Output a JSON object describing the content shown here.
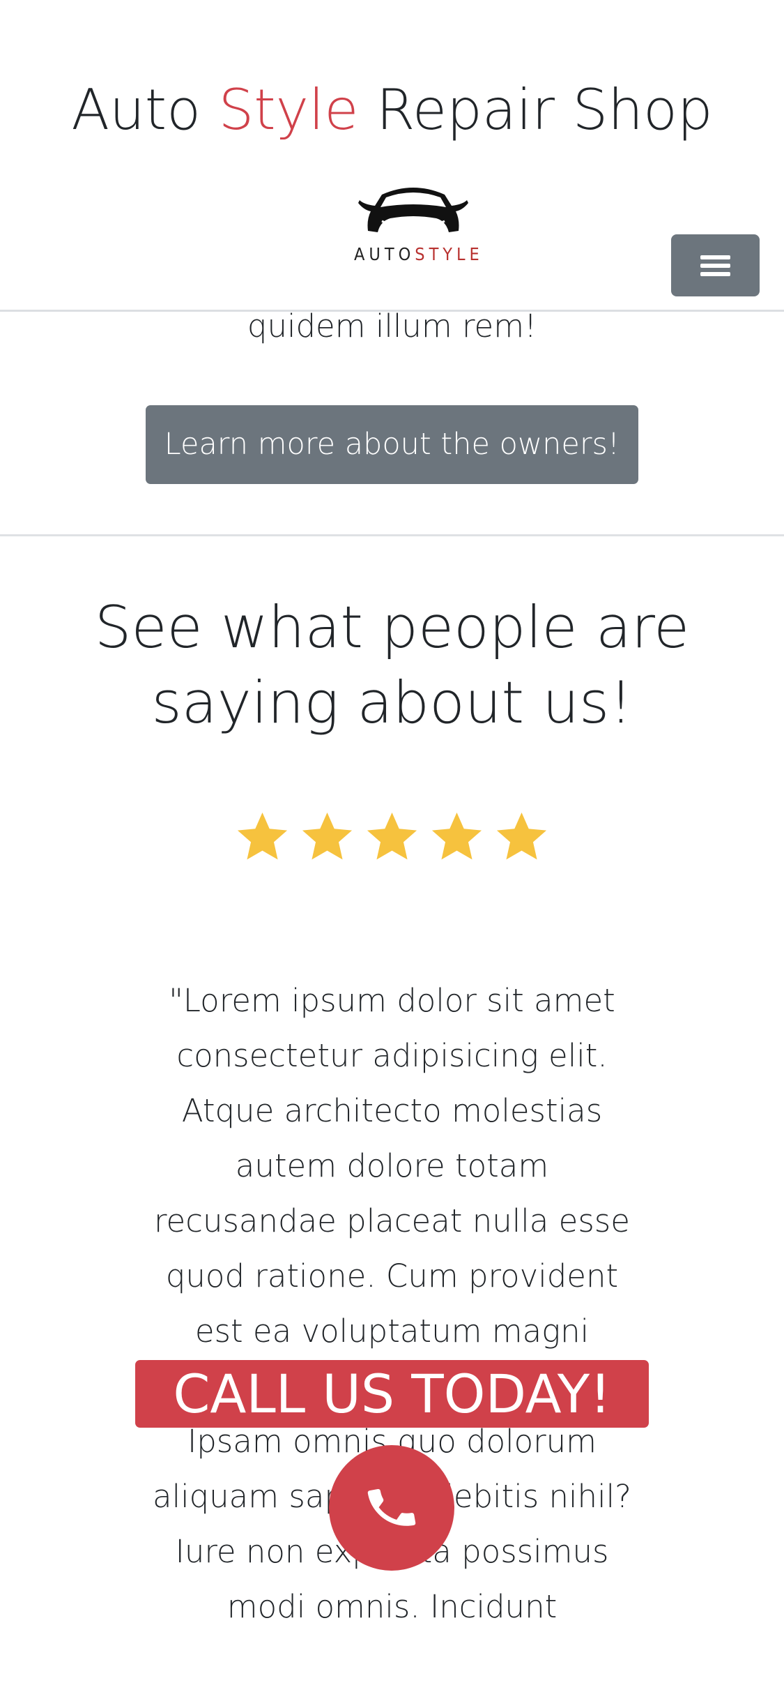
{
  "header": {
    "title_part1": "Auto",
    "title_accent": "Style",
    "title_part2": "Repair Shop",
    "logo_text_part1": "AUTO",
    "logo_text_part2": "STYLE",
    "logo_icon": "car-front-icon",
    "menu_icon": "hamburger-menu-icon"
  },
  "about": {
    "tail_text": "quidem illum rem!",
    "owners_button_label": "Learn more about the owners!"
  },
  "testimonials": {
    "heading": "See what people are saying about us!",
    "rating": 5,
    "rating_max": 5,
    "quote": "\"Lorem ipsum dolor sit amet consectetur adipisicing elit. Atque architecto molestias autem dolore totam recusandae placeat nulla esse quod ratione. Cum provident est ea voluptatum magni quaerat laboriosam, eos esse. Ipsam omnis quo dolorum aliquam sapiente debitis nihil? Iure non expedita possimus modi omnis. Incidunt"
  },
  "cta": {
    "banner_label": "CALL US TODAY!",
    "call_icon": "phone-icon"
  },
  "colors": {
    "accent": "#d0414a",
    "secondary": "#6c757d",
    "star": "#f6c23e",
    "text": "#212529"
  }
}
